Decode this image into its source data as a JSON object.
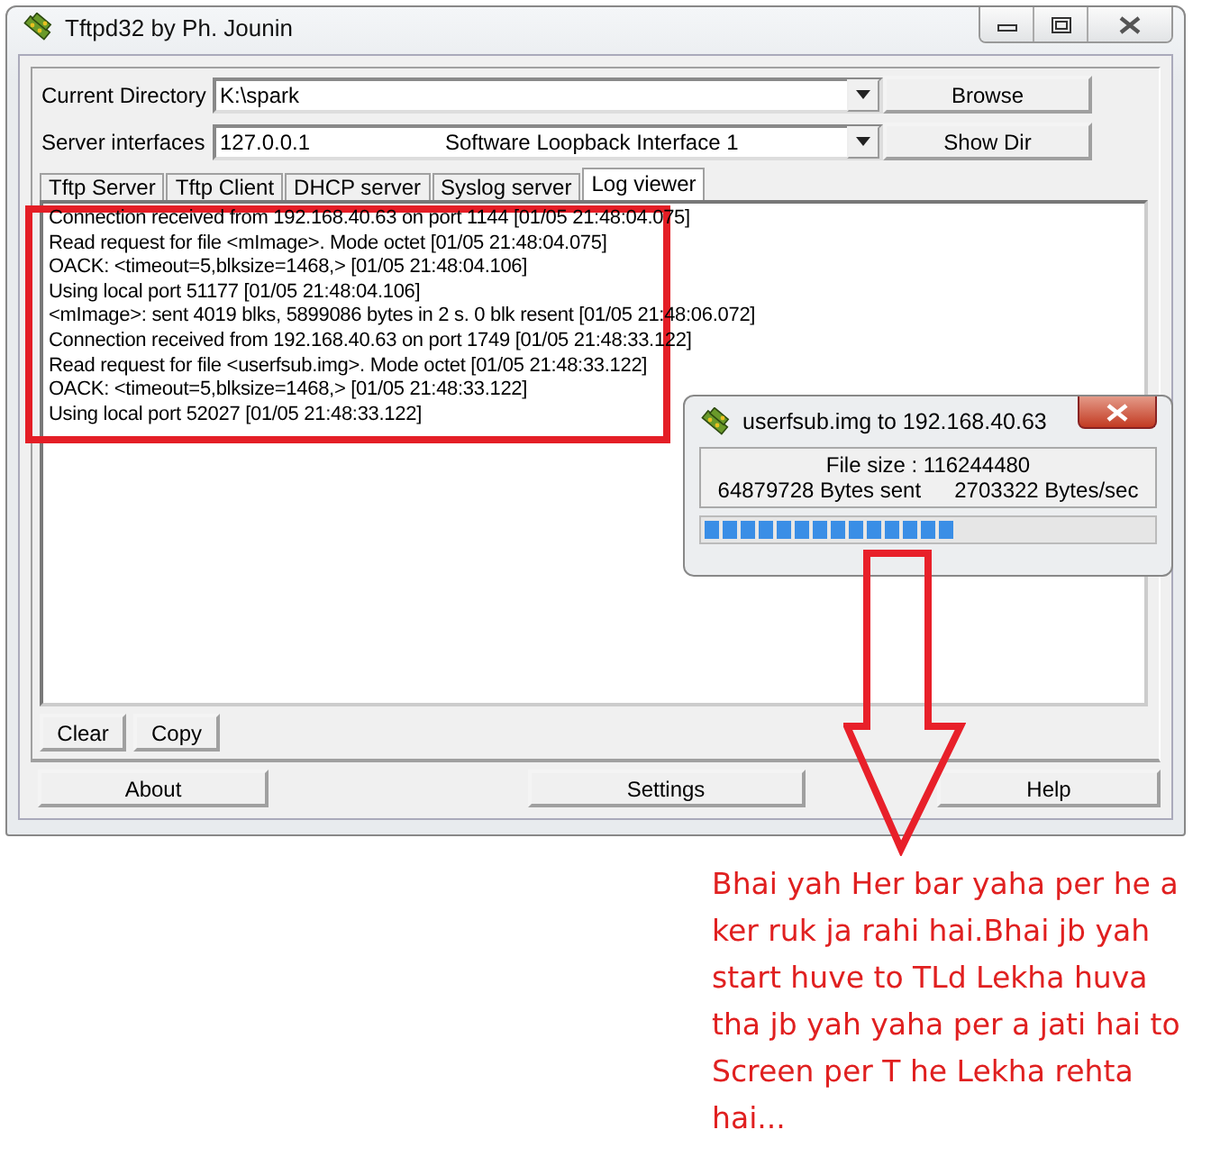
{
  "window": {
    "title": "Tftpd32 by Ph. Jounin"
  },
  "fields": [
    {
      "label": "Current Directory",
      "value": "K:\\spark"
    },
    {
      "label": "Server interfaces",
      "value": "127.0.0.1",
      "detail": "Software Loopback Interface 1"
    }
  ],
  "side_buttons": [
    "Browse",
    "Show Dir"
  ],
  "tabs": [
    {
      "label": "Tftp Server",
      "selected": false
    },
    {
      "label": "Tftp Client",
      "selected": false
    },
    {
      "label": "DHCP server",
      "selected": false
    },
    {
      "label": "Syslog server",
      "selected": false
    },
    {
      "label": "Log viewer",
      "selected": true
    }
  ],
  "log": [
    "Connection received from 192.168.40.63 on port 1144 [01/05 21:48:04.075]",
    "Read request for file <mImage>. Mode octet [01/05 21:48:04.075]",
    "OACK: <timeout=5,blksize=1468,> [01/05 21:48:04.106]",
    "Using local port 51177 [01/05 21:48:04.106]",
    "<mImage>: sent 4019 blks, 5899086 bytes in 2 s. 0 blk resent [01/05 21:48:06.072]",
    "Connection received from 192.168.40.63 on port 1749 [01/05 21:48:33.122]",
    "Read request for file <userfsub.img>. Mode octet [01/05 21:48:33.122]",
    "OACK: <timeout=5,blksize=1468,> [01/05 21:48:33.122]",
    "Using local port 52027 [01/05 21:48:33.122]"
  ],
  "log_buttons": [
    "Clear",
    "Copy"
  ],
  "bottom_buttons": [
    "About",
    "Settings",
    "Help"
  ],
  "transfer_dialog": {
    "title": "userfsub.img to 192.168.40.63",
    "file_size": "File size : 116244480",
    "bytes_sent": "64879728 Bytes sent",
    "rate": "2703322 Bytes/sec",
    "level": 0.56
  },
  "annotation": {
    "text": "Bhai yah Her bar yaha per he a ker ruk ja rahi hai.Bhai jb yah start huve to TLd Lekha huva tha jb yah yaha per a jati hai to Screen per T he Lekha rehta hai..."
  }
}
